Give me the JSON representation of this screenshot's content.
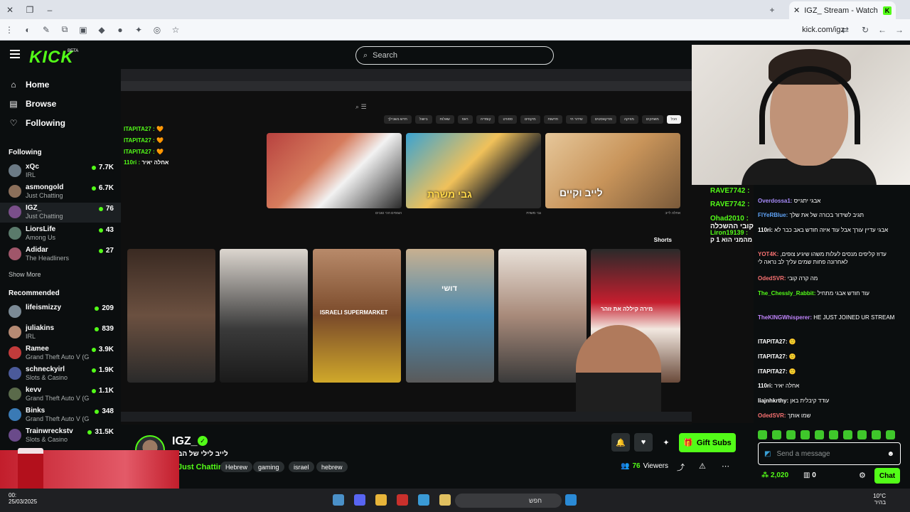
{
  "browser": {
    "tab_title": "IGZ_ Stream - Watch Live on",
    "tab_favicon": "K",
    "url": "kick.com/igz"
  },
  "header": {
    "logo": "KICK",
    "logo_badge": "BETA",
    "search_placeholder": "Search"
  },
  "sidebar": {
    "nav": [
      {
        "label": "Home",
        "icon": "home-icon"
      },
      {
        "label": "Browse",
        "icon": "browse-icon"
      },
      {
        "label": "Following",
        "icon": "heart-icon"
      }
    ],
    "following_title": "Following",
    "following": [
      {
        "name": "xQc",
        "category": "IRL",
        "viewers": "7.7K"
      },
      {
        "name": "asmongold",
        "category": "Just Chatting",
        "viewers": "6.7K"
      },
      {
        "name": "IGZ_",
        "category": "Just Chatting",
        "viewers": "76"
      },
      {
        "name": "LiorsLife",
        "category": "Among Us",
        "viewers": "43"
      },
      {
        "name": "Adidar",
        "category": "The Headliners",
        "viewers": "27"
      }
    ],
    "show_more": "Show More",
    "recommended_title": "Recommended",
    "recommended": [
      {
        "name": "lifeismizzy",
        "category": "",
        "viewers": "209"
      },
      {
        "name": "juliakins",
        "category": "IRL",
        "viewers": "839"
      },
      {
        "name": "Ramee",
        "category": "Grand Theft Auto V (G...",
        "viewers": "3.9K"
      },
      {
        "name": "schneckyirl",
        "category": "Slots & Casino",
        "viewers": "1.9K"
      },
      {
        "name": "kevv",
        "category": "Grand Theft Auto V (G...",
        "viewers": "1.1K"
      },
      {
        "name": "Binks",
        "category": "Grand Theft Auto V (G...",
        "viewers": "348"
      },
      {
        "name": "Trainwreckstv",
        "category": "Slots & Casino",
        "viewers": "31.5K"
      }
    ]
  },
  "video_overlay": {
    "chat_lines": [
      {
        "user": "ITAPITA27 :",
        "text": ""
      },
      {
        "user": "ITAPITA27 :",
        "text": ""
      },
      {
        "user": "ITAPITA27 :",
        "text": ""
      },
      {
        "user": "110ri :",
        "text": "אחלה יאיר"
      }
    ],
    "yt_chips": [
      "הכל",
      "משחקים",
      "מוזיקה",
      "פודקאסטים",
      "שידור חי",
      "חדשות",
      "מיקסים",
      "ספורט",
      "קומדיה",
      "ראפ",
      "שאלות",
      "בישול",
      "חדש בשבילך"
    ],
    "thumb_captions": [
      "",
      "גבי משרת",
      "לייב וקיים"
    ],
    "short_captions": [
      "",
      "",
      "ISRAELI SUPERMARKET",
      "דושי",
      "",
      "מירה קיללה את זוהר"
    ],
    "shorts_label": "Shorts",
    "thumb_meta": [
      "הצופים הכי טובים",
      "גבי משרת",
      "אחלה לייב"
    ]
  },
  "stream": {
    "name": "IGZ_",
    "title": "לייב לילי של הבית",
    "category": "Just Chatting",
    "tags": [
      "Hebrew",
      "gaming",
      "israel",
      "hebrew"
    ],
    "viewers": "76",
    "viewers_label": "Viewers",
    "gift_label": "Gift Subs"
  },
  "side_chat": [
    {
      "user": "RAVE7742 :",
      "text": ""
    },
    {
      "user": "RAVE7742 :",
      "text": ""
    },
    {
      "user": "Ohad2010 :",
      "text": "קובי ההשכלה"
    },
    {
      "user": "Liron19139 :",
      "text": "מהמני הוא 1 ק"
    }
  ],
  "chat": {
    "messages": [
      {
        "user": "Overdossa1:",
        "color": "#a78bfa",
        "text": "אבגי יתגייס"
      },
      {
        "user": "FlYeRBlue:",
        "color": "#60a5fa",
        "text": "תגיב לשידור בכורה של את שלך"
      },
      {
        "user": "110ri:",
        "color": "#ffffff",
        "text": "אבגי עדיין עורך אבל עוד איזה חודש באב כבר לא"
      },
      {
        "user": "YOT4K:",
        "color": "#f87171",
        "text": "עדוז קליפים מנסים לעלות משהו שיגיע צופים, לאחרונה פחות שמים עליך לב נראה לי"
      },
      {
        "user": "OdedSVR:",
        "color": "#f87171",
        "text": "מה קרה קובי"
      },
      {
        "user": "The_Chessly_Rabbit:",
        "color": "#53fc18",
        "text": "עוד חודש אבגי מתחיל"
      },
      {
        "user": "TheKINGWhisperer:",
        "color": "#c084fc",
        "text": "HE JUST JOINED UR STREAM"
      },
      {
        "user": "ITAPITA27:",
        "color": "#ffffff",
        "text": ""
      },
      {
        "user": "ITAPITA27:",
        "color": "#ffffff",
        "text": ""
      },
      {
        "user": "ITAPITA27:",
        "color": "#ffffff",
        "text": ""
      },
      {
        "user": "110ri:",
        "color": "#ffffff",
        "text": "אחלה יאיר"
      },
      {
        "user": "liajnhkrthy:",
        "color": "#ffffff",
        "text": "עודד קיבלית באן"
      },
      {
        "user": "OdedSVR:",
        "color": "#f87171",
        "text": "שמו אותך"
      }
    ],
    "input_placeholder": "Send a message",
    "points": "2,020",
    "redeem": "0",
    "chat_button": "Chat"
  },
  "taskbar": {
    "time": "00:",
    "date": "25/03/2025",
    "search": "חפש",
    "weather": "10°C",
    "weather_sub": "בהיר"
  },
  "colors": {
    "kick_green": "#53fc18",
    "bg": "#0b0e0f"
  }
}
